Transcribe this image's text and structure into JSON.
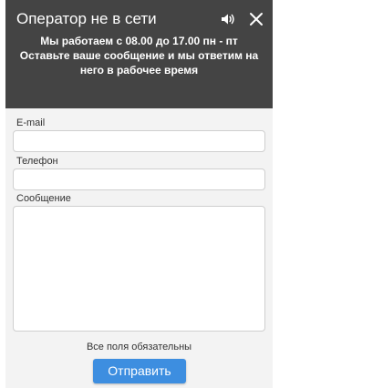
{
  "header": {
    "title": "Оператор не в сети",
    "subtitle_line1": "Мы работаем с 08.00 до 17.00 пн - пт",
    "subtitle_line2": "Оставьте ваше сообщение и мы ответим на",
    "subtitle_line3": "него в рабочее время",
    "sound_icon": "speaker-icon",
    "close_icon": "close-icon"
  },
  "form": {
    "email_label": "E-mail",
    "email_value": "",
    "phone_label": "Телефон",
    "phone_value": "",
    "message_label": "Сообщение",
    "message_value": "",
    "required_note": "Все поля обязательны",
    "submit_label": "Отправить"
  },
  "colors": {
    "header_bg": "#444444",
    "form_bg": "#f3f3f3",
    "accent": "#3d8ee0"
  }
}
